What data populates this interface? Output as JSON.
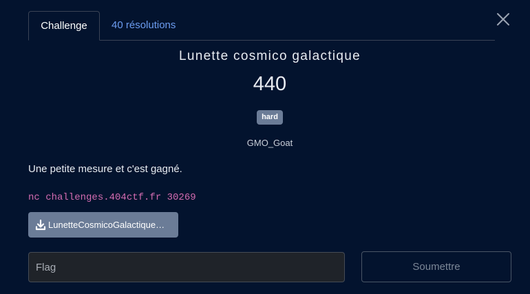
{
  "tabs": {
    "challenge_label": "Challenge",
    "solves_label": "40 résolutions"
  },
  "challenge": {
    "name": "Lunette cosmico galactique",
    "points": "440",
    "difficulty": "hard",
    "author": "GMO_Goat",
    "description": "Une petite mesure et c'est gagné.",
    "connection_command": "nc challenges.404ctf.fr 30269",
    "file_label": "LunetteCosmicoGalactique…"
  },
  "form": {
    "flag_placeholder": "Flag",
    "flag_value": "",
    "submit_label": "Soumettre"
  },
  "icons": {
    "close": "close-icon",
    "download": "download-icon"
  },
  "colors": {
    "background": "#03132e",
    "link": "#6c9cf0",
    "badge": "#6b7c97",
    "command": "#d36bb0",
    "input_background": "#1f2329"
  }
}
